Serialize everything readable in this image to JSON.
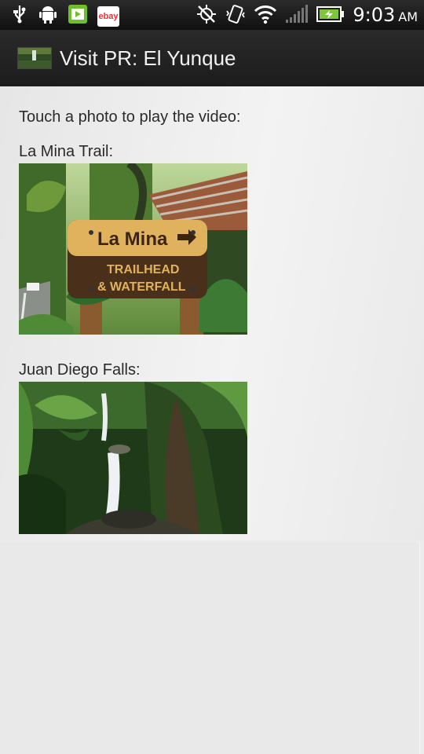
{
  "status_bar": {
    "time": "9:03",
    "ampm": "AM",
    "ebay_label": "ebay"
  },
  "app_bar": {
    "title": "Visit PR: El Yunque"
  },
  "content": {
    "intro": "Touch a photo to play the video:",
    "videos": [
      {
        "label": "La Mina Trail:",
        "sign_line1": "La Mina",
        "sign_line2": "TRAILHEAD",
        "sign_line3": "& WATERFALL"
      },
      {
        "label": "Juan Diego Falls:"
      }
    ]
  },
  "colors": {
    "status_bar": "#101010",
    "action_bar": "#222222",
    "background": "#ececec",
    "battery": "#7ec73a"
  },
  "icons": [
    "usb-icon",
    "android-icon",
    "media-icon",
    "ebay-icon",
    "gps-off-icon",
    "vibrate-icon",
    "wifi-icon",
    "signal-icon",
    "battery-charging-icon"
  ]
}
